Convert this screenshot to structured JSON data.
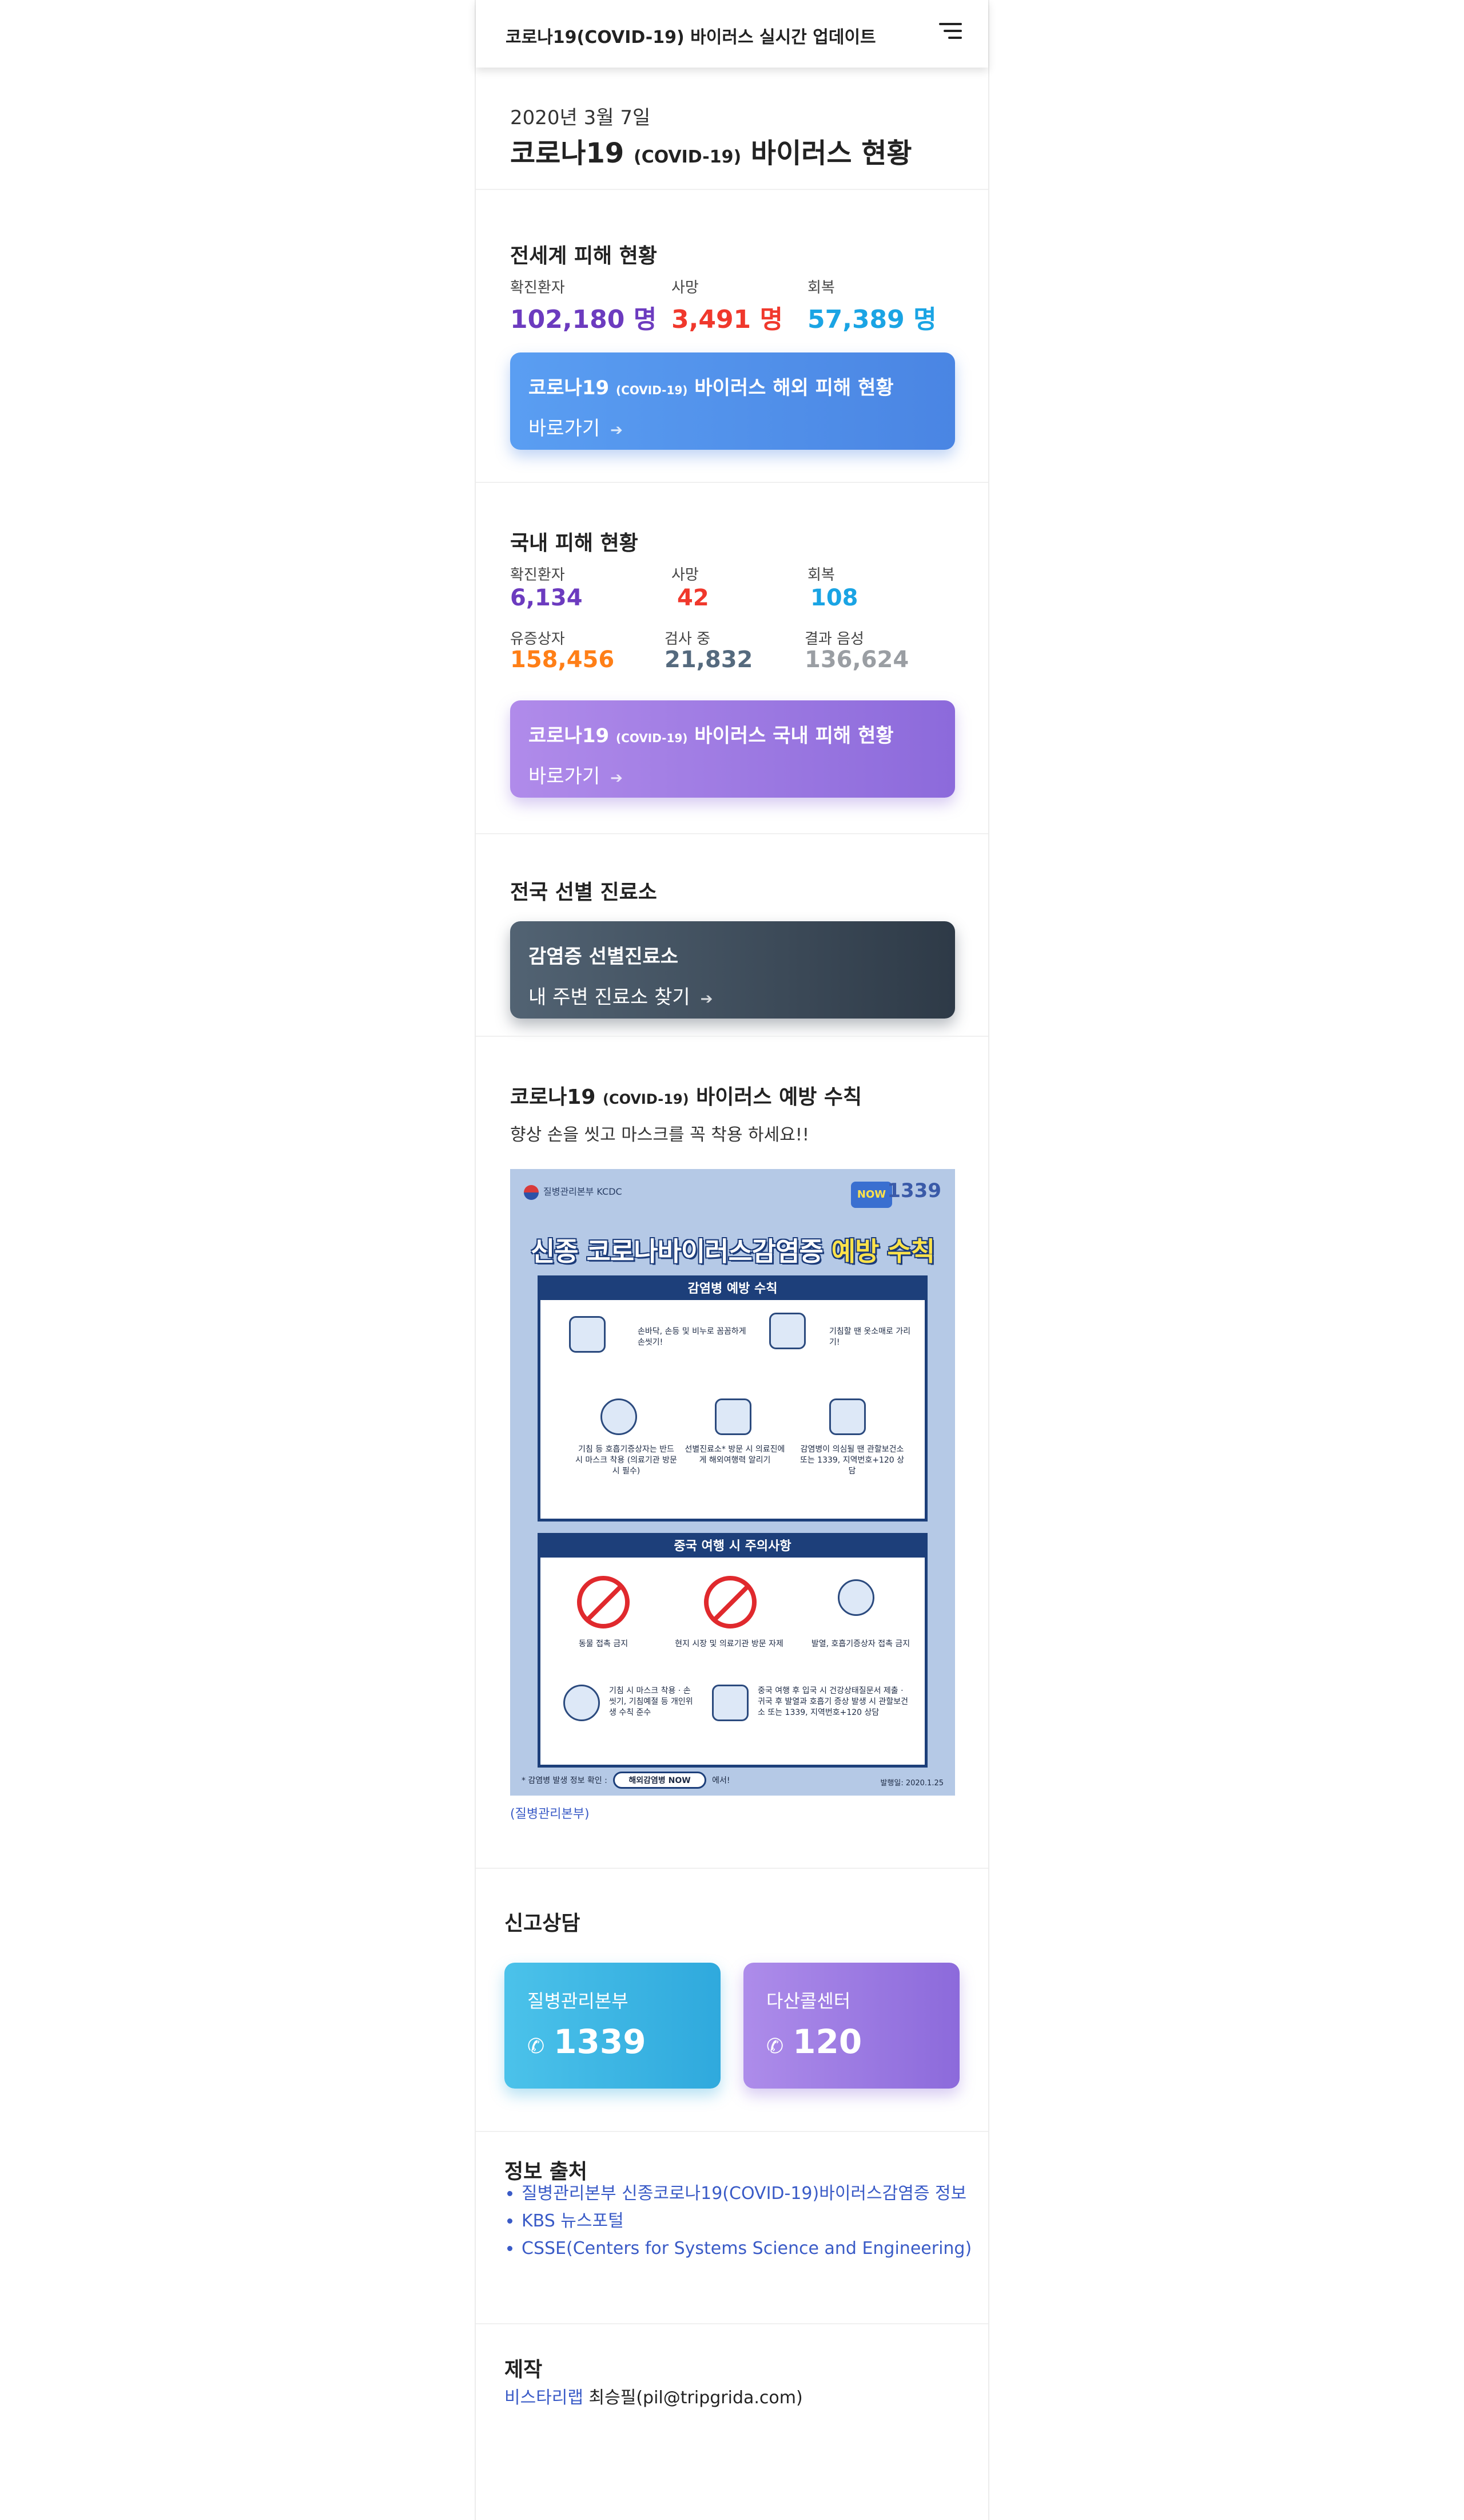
{
  "header": {
    "title": "코로나19(COVID-19) 바이러스 실시간 업데이트"
  },
  "hero": {
    "date": "2020년 3월 7일",
    "title_main": "코로나19",
    "title_small": "(COVID-19)",
    "title_rest": "바이러스 현황"
  },
  "world": {
    "heading": "전세계 피해 현황",
    "confirmed_label": "확진환자",
    "confirmed_value": "102,180 명",
    "deaths_label": "사망",
    "deaths_value": "3,491 명",
    "recovered_label": "회복",
    "recovered_value": "57,389 명",
    "card_title_main": "코로나19",
    "card_title_small": "(COVID-19)",
    "card_title_rest": "바이러스 해외 피해 현황",
    "card_link": "바로가기"
  },
  "domestic": {
    "heading": "국내 피해 현황",
    "confirmed_label": "확진환자",
    "confirmed_value": "6,134",
    "deaths_label": "사망",
    "deaths_value": "42",
    "recovered_label": "회복",
    "recovered_value": "108",
    "suspected_label": "유증상자",
    "suspected_value": "158,456",
    "testing_label": "검사 중",
    "testing_value": "21,832",
    "negative_label": "결과 음성",
    "negative_value": "136,624",
    "card_title_main": "코로나19",
    "card_title_small": "(COVID-19)",
    "card_title_rest": "바이러스 국내 피해 현황",
    "card_link": "바로가기"
  },
  "clinic": {
    "heading": "전국 선별 진료소",
    "card_title": "감염증 선별진료소",
    "card_link": "내 주변 진료소 찾기"
  },
  "prevention": {
    "heading_main": "코로나19",
    "heading_small": "(COVID-19)",
    "heading_rest": "바이러스 예방 수칙",
    "subtitle": "향상 손을 씻고 마스크를 꼭 착용 하세요!!",
    "caption": "(질병관리본부)",
    "poster": {
      "org": "질병관리본부 KCDC",
      "now_badge": "NOW",
      "logo": "1339",
      "title_plain": "신종 코로나바이러스감염증",
      "title_highlight": "예방 수칙",
      "box1_heading": "감염병 예방 수칙",
      "item1": "손바닥, 손등 및 비누로 꼼꼼하게 손씻기!",
      "item2": "기침할 땐 옷소매로 가리기!",
      "item3": "기침 등 호흡기증상자는 반드시 마스크 착용 (의료기관 방문 시 필수)",
      "item4": "선별진료소* 방문 시 의료진에게 해외여행력 알리기",
      "item5": "감염병이 의심될 땐 관할보건소 또는 1339, 지역번호+120 상담",
      "box2_heading": "중국 여행 시 주의사항",
      "item6": "동물 접촉 금지",
      "item7": "현지 시장 및 의료기관 방문 자제",
      "item8": "발열, 호흡기증상자 접촉 금지",
      "item9": "기침 시 마스크 착용 · 손씻기, 기침예절 등 개인위생 수칙 준수",
      "item10": "중국 여행 후 입국 시 건강상태질문서 제출 · 귀국 후 발열과 호흡기 증상 발생 시 관할보건소 또는 1339, 지역번호+120 상담",
      "footer_prefix": "* 감염병 발생 정보 확인 :",
      "footer_badge": "해외감염병 NOW",
      "footer_suffix": "에서!",
      "date": "발행일: 2020.1.25"
    }
  },
  "report": {
    "heading": "신고상담",
    "kcdc_label": "질병관리본부",
    "kcdc_number": "1339",
    "dasan_label": "다산콜센터",
    "dasan_number": "120"
  },
  "sources": {
    "heading": "정보 출처",
    "items": [
      "질병관리본부 신종코로나19(COVID-19)바이러스감염증 정보",
      "KBS 뉴스포털",
      "CSSE(Centers for Systems Science and Engineering)"
    ]
  },
  "credits": {
    "heading": "제작",
    "org": "비스타리랩",
    "person": "최승필(pil@tripgrida.com)"
  },
  "icons": {
    "menu": "hamburger-menu-icon",
    "arrow": "arrow-right-icon",
    "phone": "phone-icon"
  },
  "colors": {
    "world_card": "#4a85e3",
    "domestic_card": "#8c6adb",
    "clinic_card": "#2e3a47",
    "confirmed": "#6c3bbf",
    "deaths": "#f0382c",
    "recovered": "#1aa4e4",
    "suspected": "#ff7f17"
  }
}
